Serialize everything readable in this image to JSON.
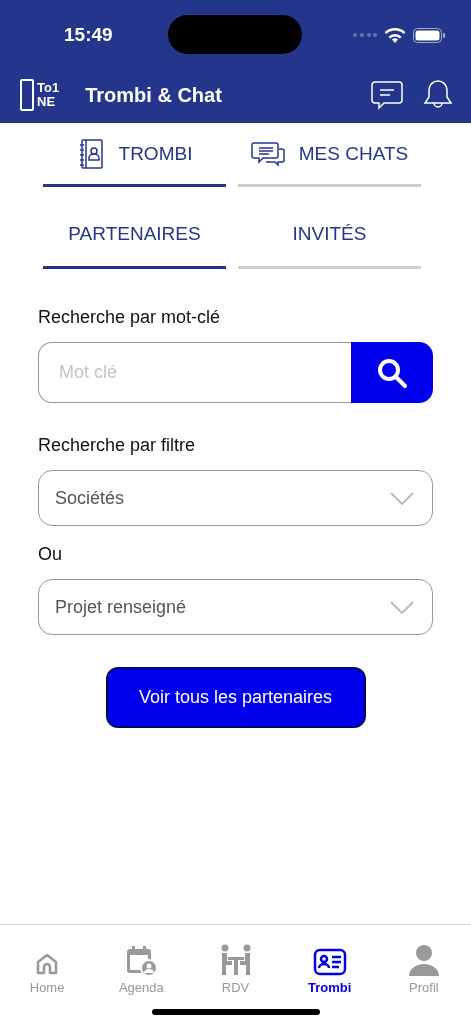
{
  "status_bar": {
    "time": "15:49"
  },
  "header": {
    "logo_top": "To1",
    "logo_bottom": "NE",
    "title": "Trombi & Chat"
  },
  "tabs": [
    {
      "label": "TROMBI",
      "kind": "directory",
      "selected": true
    },
    {
      "label": "MES CHATS",
      "kind": "chats",
      "selected": false
    }
  ],
  "subtabs": [
    {
      "label": "PARTENAIRES",
      "selected": true
    },
    {
      "label": "INVITÉS",
      "selected": false
    }
  ],
  "keyword": {
    "label": "Recherche par mot-clé",
    "placeholder": "Mot clé"
  },
  "filter": {
    "label": "Recherche par filtre",
    "select": "Sociétés"
  },
  "or": {
    "label": "Ou",
    "select": "Projet renseigné"
  },
  "action_button": "Voir tous les partenaires",
  "nav": [
    {
      "label": "Home",
      "kind": "home",
      "selected": false
    },
    {
      "label": "Agenda",
      "kind": "agenda",
      "selected": false
    },
    {
      "label": "RDV",
      "kind": "meeting",
      "selected": false
    },
    {
      "label": "Trombi",
      "kind": "trombi",
      "selected": true
    },
    {
      "label": "Profil",
      "kind": "profile",
      "selected": false
    }
  ]
}
